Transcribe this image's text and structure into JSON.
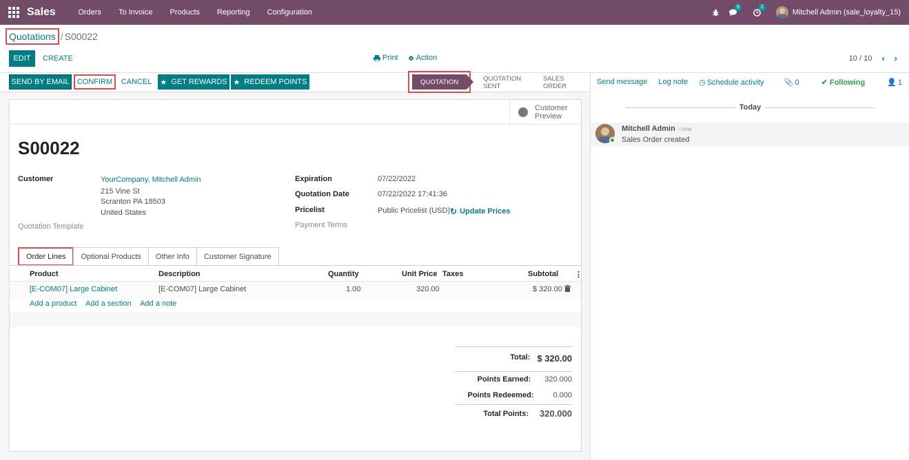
{
  "navbar": {
    "app_name": "Sales",
    "menu": [
      "Orders",
      "To Invoice",
      "Products",
      "Reporting",
      "Configuration"
    ],
    "messages_count": "5",
    "activities_count": "2",
    "user": "Mitchell Admin (sale_loyalty_15)"
  },
  "control": {
    "breadcrumb_parent": "Quotations",
    "breadcrumb_sep": "/",
    "breadcrumb_current": "S00022",
    "edit": "EDIT",
    "create": "CREATE",
    "print": "Print",
    "action": "Action",
    "pager": "10 / 10"
  },
  "statusbar": {
    "send_email": "SEND BY EMAIL",
    "confirm": "CONFIRM",
    "cancel": "CANCEL",
    "get_rewards": "GET REWARDS",
    "redeem_points": "REDEEM POINTS",
    "stages": [
      "QUOTATION",
      "QUOTATION SENT",
      "SALES ORDER"
    ],
    "active_stage": "QUOTATION"
  },
  "form": {
    "customer_preview_1": "Customer",
    "customer_preview_2": "Preview",
    "title": "S00022",
    "customer_label": "Customer",
    "customer_name": "YourCompany, Mitchell Admin",
    "address_1": "215 Vine St",
    "address_2": "Scranton PA 18503",
    "address_3": "United States",
    "quotation_template_label": "Quotation Template",
    "expiration_label": "Expiration",
    "expiration_value": "07/22/2022",
    "quotation_date_label": "Quotation Date",
    "quotation_date_value": "07/22/2022 17:41:36",
    "pricelist_label": "Pricelist",
    "pricelist_value": "Public Pricelist (USD)",
    "update_prices": "Update Prices",
    "payment_terms_label": "Payment Terms"
  },
  "tabs": [
    "Order Lines",
    "Optional Products",
    "Other Info",
    "Customer Signature"
  ],
  "order_lines": {
    "columns": [
      "Product",
      "Description",
      "Quantity",
      "Unit Price",
      "Taxes",
      "Subtotal"
    ],
    "rows": [
      {
        "product": "[E-COM07] Large Cabinet",
        "description": "[E-COM07] Large Cabinet",
        "quantity": "1.00",
        "unit_price": "320.00",
        "taxes": "",
        "subtotal": "$ 320.00"
      }
    ],
    "add_product": "Add a product",
    "add_section": "Add a section",
    "add_note": "Add a note"
  },
  "totals": {
    "total_label": "Total:",
    "total_value": "$ 320.00",
    "points_earned_label": "Points Earned:",
    "points_earned_value": "320.000",
    "points_redeemed_label": "Points Redeemed:",
    "points_redeemed_value": "0.000",
    "total_points_label": "Total Points:",
    "total_points_value": "320.000"
  },
  "chatter": {
    "send_message": "Send message",
    "log_note": "Log note",
    "schedule_activity": "Schedule activity",
    "attachments": "0",
    "following": "Following",
    "followers": "1",
    "today": "Today",
    "message_author": "Mitchell Admin",
    "message_time": "- now",
    "message_body": "Sales Order created"
  },
  "colors": {
    "brand": "#714b67",
    "accent": "#017e84",
    "highlight": "#e04b4b",
    "following": "#28a745"
  }
}
